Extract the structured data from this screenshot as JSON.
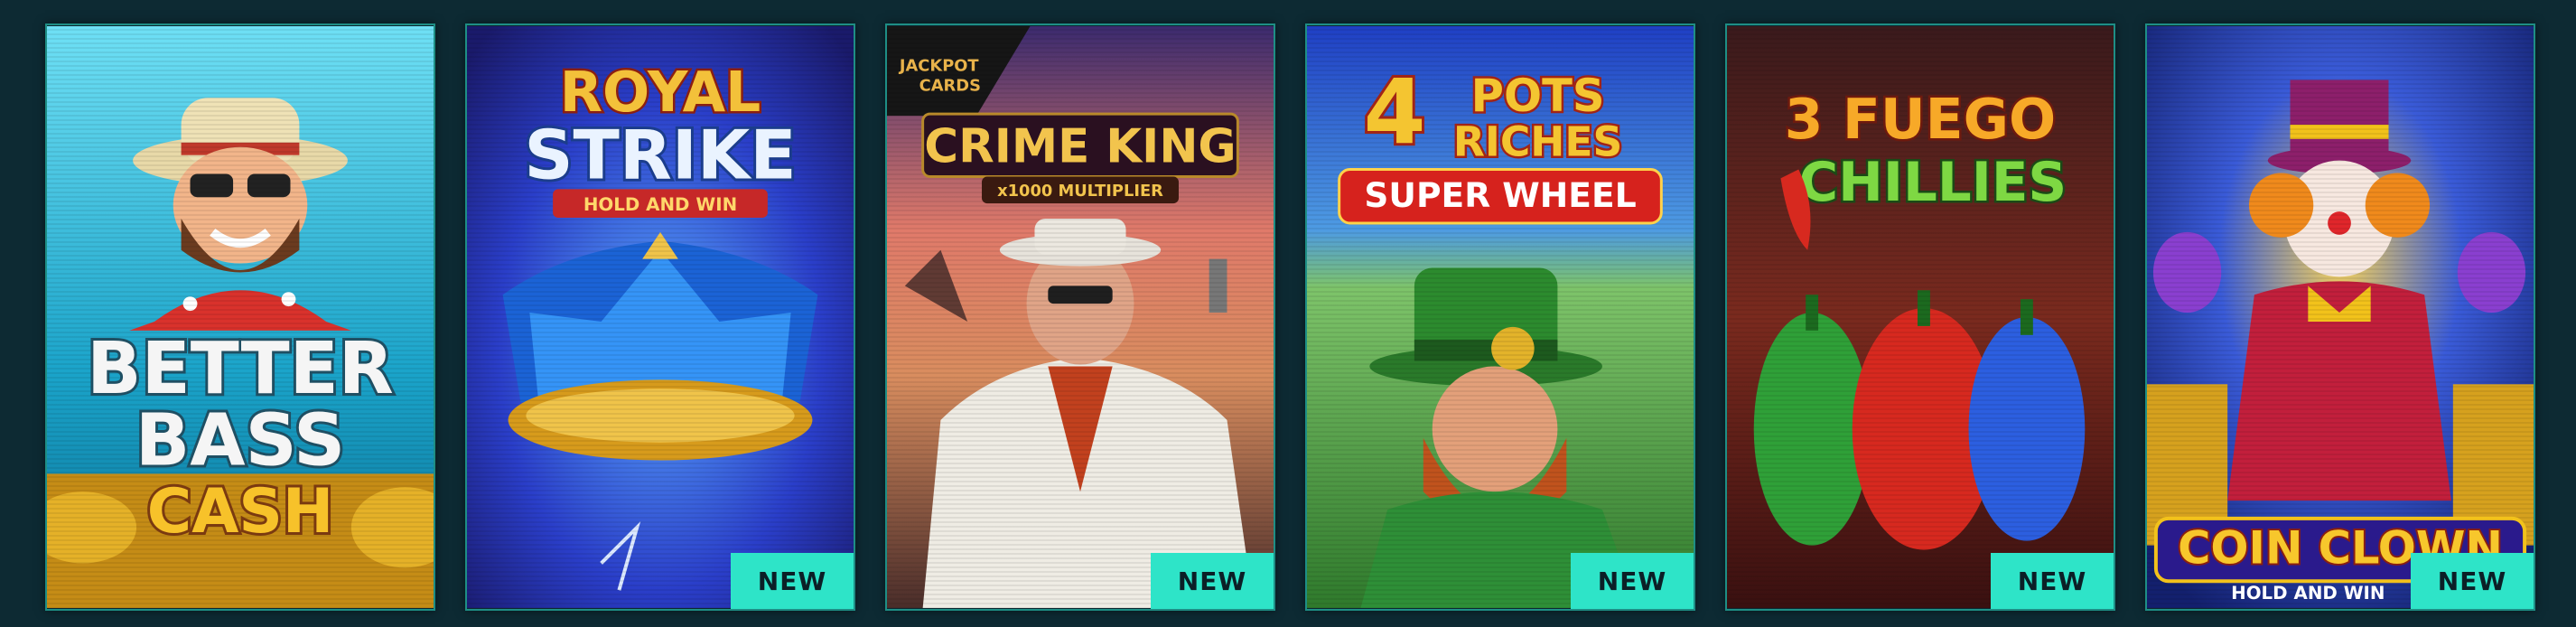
{
  "games": [
    {
      "title_lines": [
        "BETTER",
        "BASS",
        "CASH"
      ],
      "badge": ""
    },
    {
      "title_lines": [
        "ROYAL",
        "STRIKE"
      ],
      "subtitle": "HOLD AND WIN",
      "badge": "NEW"
    },
    {
      "title_lines": [
        "CRIME KING"
      ],
      "subtitle": "x1000 MULTIPLIER",
      "brand_lines": [
        "JACKPOT",
        "CARDS"
      ],
      "badge": "NEW"
    },
    {
      "title_lines": [
        "4",
        "POTS",
        "RICHES",
        "SUPER WHEEL"
      ],
      "badge": "NEW"
    },
    {
      "title_lines": [
        "3 FUEGO",
        "CHILLIES"
      ],
      "badge": "NEW"
    },
    {
      "title_lines": [
        "COIN CLOWN"
      ],
      "subtitle": "HOLD AND WIN",
      "badge": "NEW"
    }
  ],
  "colors": {
    "accent": "#2ee4c8",
    "background": "#0d2a33"
  },
  "icons": [
    "fisherman-icon",
    "crown-icon",
    "gangster-icon",
    "leprechaun-icon",
    "chilli-peppers-icon",
    "clown-icon"
  ]
}
